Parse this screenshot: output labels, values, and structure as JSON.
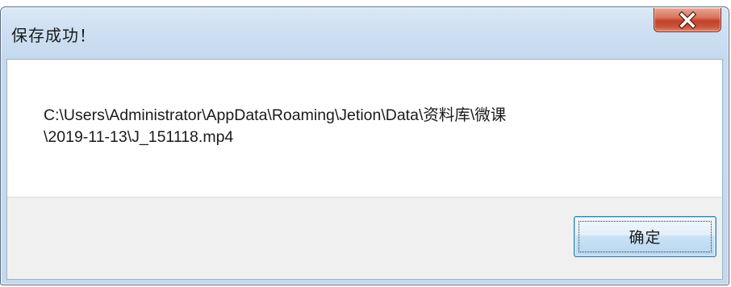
{
  "window": {
    "title": "保存成功！",
    "close_icon": "close-x-icon"
  },
  "message": {
    "lines": [
      "C:\\Users\\Administrator\\AppData\\Roaming\\Jetion\\Data\\资料库\\微课",
      "\\2019-11-13\\J_151118.mp4"
    ]
  },
  "buttons": {
    "ok_label": "确定"
  },
  "colors": {
    "close_button": "#c4412a",
    "frame": "#c6daef",
    "button_border": "#3c7fb1"
  }
}
